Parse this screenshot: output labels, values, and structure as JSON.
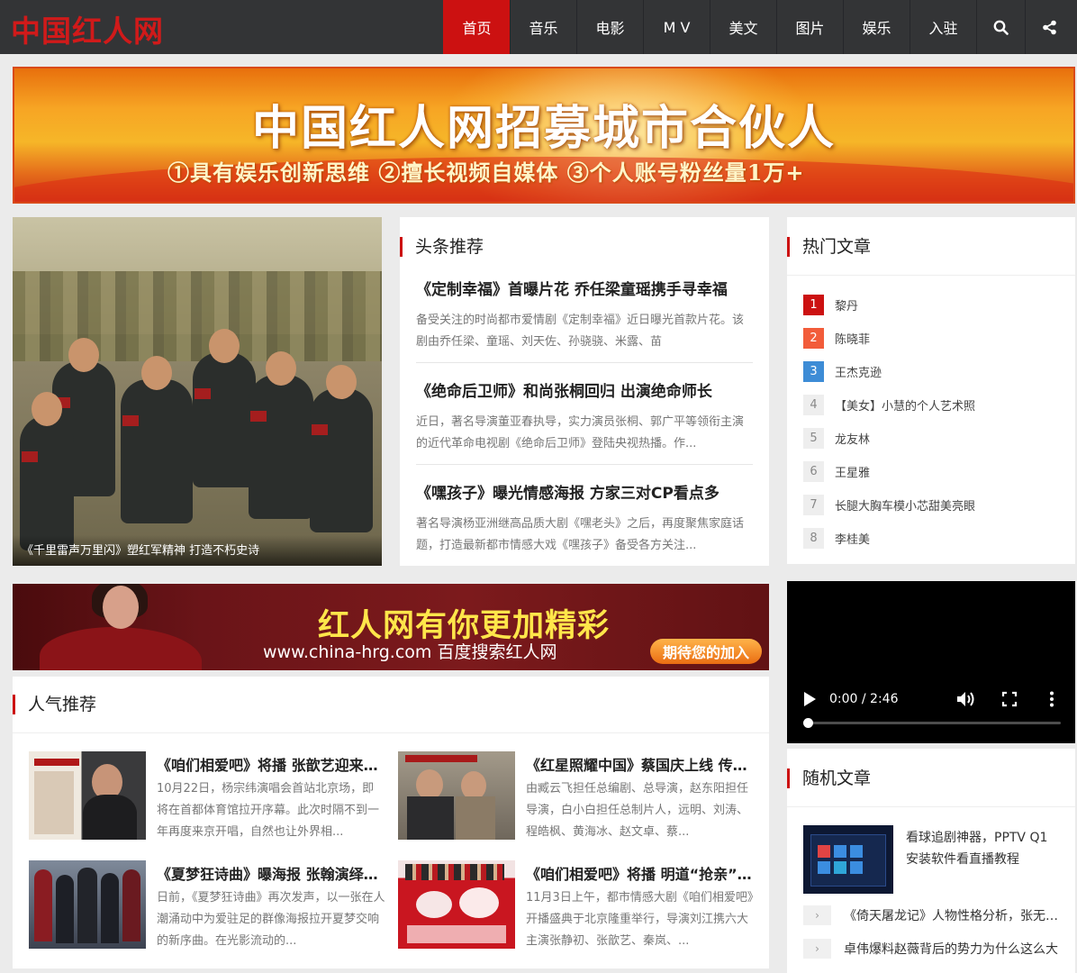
{
  "header": {
    "logo": "中国红人网",
    "nav": [
      "首页",
      "音乐",
      "电影",
      "M V",
      "美文",
      "图片",
      "娱乐",
      "入驻"
    ],
    "active_index": 0,
    "search_icon": "search-icon",
    "share_icon": "share-icon"
  },
  "banner_top": {
    "title": "中国红人网招募城市合伙人",
    "subtitle": "①具有娱乐创新思维 ②擅长视频自媒体 ③个人账号粉丝量1万+"
  },
  "feature": {
    "caption": "《千里雷声万里闪》塑红军精神 打造不朽史诗"
  },
  "headlines": {
    "title": "头条推荐",
    "items": [
      {
        "title": "《定制幸福》首曝片花 乔任梁童瑶携手寻幸福",
        "desc": "备受关注的时尚都市爱情剧《定制幸福》近日曝光首款片花。该剧由乔任梁、童瑶、刘天佐、孙骁骁、米露、苗"
      },
      {
        "title": "《绝命后卫师》和尚张桐回归 出演绝命师长",
        "desc": "近日，著名导演董亚春执导，实力演员张桐、郭广平等领衔主演的近代革命电视剧《绝命后卫师》登陆央视热播。作..."
      },
      {
        "title": "《嘿孩子》曝光情感海报 方家三对CP看点多",
        "desc": "著名导演杨亚洲继高品质大剧《嘿老头》之后，再度聚焦家庭话题，打造最新都市情感大戏《嘿孩子》备受各方关注..."
      }
    ]
  },
  "hot": {
    "title": "热门文章",
    "items": [
      {
        "rank": "1",
        "label": "黎丹"
      },
      {
        "rank": "2",
        "label": "陈晓菲"
      },
      {
        "rank": "3",
        "label": "王杰克逊"
      },
      {
        "rank": "4",
        "label": "【美女】小慧的个人艺术照"
      },
      {
        "rank": "5",
        "label": "龙友林"
      },
      {
        "rank": "6",
        "label": "王星雅"
      },
      {
        "rank": "7",
        "label": "长腿大胸车模小芯甜美亮眼"
      },
      {
        "rank": "8",
        "label": "李桂美"
      }
    ]
  },
  "banner_mid": {
    "title": "红人网有你更加精彩",
    "subtitle": "www.china-hrg.com 百度搜索红人网",
    "button": "期待您的加入"
  },
  "popular": {
    "title": "人气推荐",
    "items": [
      {
        "title": "《咱们相爱吧》将播 张歆艺迎来好运",
        "desc": "10月22日，杨宗纬演唱会首站北京场，即将在首都体育馆拉开序幕。此次时隔不到一年再度来京开唱，自然也让外界相..."
      },
      {
        "title": "《红星照耀中国》蔡国庆上线 传递红色正能量",
        "desc": "由臧云飞担任总编剧、总导演，赵东阳担任导演，白小白担任总制片人，远明、刘涛、程皓枫、黄海冰、赵文卓、蔡..."
      },
      {
        "title": "《夏梦狂诗曲》曝海报 张翰演绎双重人格",
        "desc": "日前，《夏梦狂诗曲》再次发声，以一张在人潮涌动中为爱驻足的群像海报拉开夏梦交响的新序曲。在光影流动的..."
      },
      {
        "title": "《咱们相爱吧》将播 明道“抢亲”张歆艺",
        "desc": "11月3日上午，都市情感大剧《咱们相爱吧》开播盛典于北京隆重举行，导演刘江携六大主演张静初、张歆艺、秦岚、..."
      }
    ]
  },
  "video": {
    "time": "0:00 / 2:46",
    "progress": 0
  },
  "random": {
    "title": "随机文章",
    "feature_title": "看球追剧神器，PPTV Q1安装软件看直播教程",
    "items": [
      {
        "arrow": "›",
        "label": "《倚天屠龙记》人物性格分析，张无忌为什么受欢迎"
      },
      {
        "arrow": "›",
        "label": "卓伟爆料赵薇背后的势力为什么这么大"
      }
    ]
  }
}
